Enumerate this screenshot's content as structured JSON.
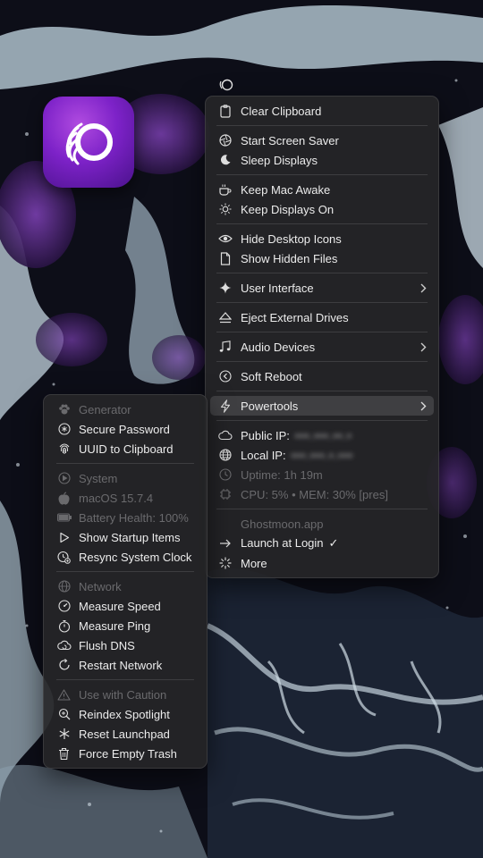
{
  "menubar": {
    "icon": "ghost-moon-icon"
  },
  "app": {
    "name": "Ghostmoon",
    "icon": "app-icon"
  },
  "main_menu": {
    "clear_clipboard": "Clear Clipboard",
    "start_screen_saver": "Start Screen Saver",
    "sleep_displays": "Sleep Displays",
    "keep_mac_awake": "Keep Mac Awake",
    "keep_displays_on": "Keep Displays On",
    "hide_desktop_icons": "Hide Desktop Icons",
    "show_hidden_files": "Show Hidden Files",
    "user_interface": "User Interface",
    "eject_external_drives": "Eject External Drives",
    "audio_devices": "Audio Devices",
    "soft_reboot": "Soft Reboot",
    "powertools": "Powertools",
    "public_ip_label": "Public IP:",
    "public_ip_value": "•••.•••.••.•",
    "local_ip_label": "Local IP:",
    "local_ip_value": "•••.•••.•.•••",
    "uptime": "Uptime: 1h 19m",
    "cpu_mem": "CPU: 5% • MEM: 30% [pres]",
    "app_site": "Ghostmoon.app",
    "launch_at_login": "Launch at Login",
    "launch_at_login_check": "✓",
    "more": "More"
  },
  "sub_menu": {
    "generator": "Generator",
    "secure_password": "Secure Password",
    "uuid_to_clipboard": "UUID to Clipboard",
    "system": "System",
    "macos_version": "macOS 15.7.4",
    "battery_health": "Battery Health: 100%",
    "show_startup_items": "Show Startup Items",
    "resync_system_clock": "Resync System Clock",
    "network": "Network",
    "measure_speed": "Measure Speed",
    "measure_ping": "Measure Ping",
    "flush_dns": "Flush DNS",
    "restart_network": "Restart Network",
    "use_with_caution": "Use with Caution",
    "reindex_spotlight": "Reindex Spotlight",
    "reset_launchpad": "Reset Launchpad",
    "force_empty_trash": "Force Empty Trash"
  },
  "colors": {
    "menu_bg": "#262628",
    "text": "#ececec",
    "disabled": "#6a6a6d",
    "accent_purple": "#7d22c8"
  }
}
